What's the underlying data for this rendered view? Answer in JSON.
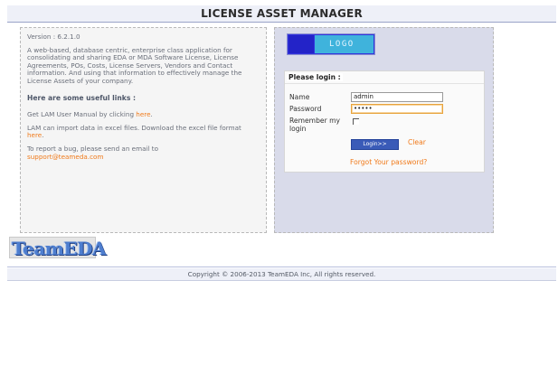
{
  "header": {
    "title": "LICENSE ASSET MANAGER"
  },
  "info": {
    "version": "Version : 6.2.1.0",
    "description": "A web-based, database centric, enterprise class application for consolidating and sharing EDA or MDA Software License, License Agreements, POs, Costs, License Servers, Vendors and Contact information. And using that information to effectively manage the License Assets of your company.",
    "links_heading": "Here are some useful links :",
    "manual_text": "Get LAM User Manual by clicking ",
    "manual_link": "here",
    "manual_suffix": ".",
    "import_text": "LAM can import data in excel files. Download the excel file format ",
    "import_link": "here",
    "import_suffix": ".",
    "bug_text": "To report a bug, please send an email to",
    "bug_email": "support@teameda.com"
  },
  "logo": {
    "text": "LOGO"
  },
  "login": {
    "title": "Please login :",
    "name_label": "Name",
    "name_value": "admin",
    "password_label": "Password",
    "password_value": "•••••",
    "remember_label_1": "Remember my",
    "remember_label_2": "login",
    "login_button": "Login>>",
    "clear_link": "Clear",
    "forgot_link": "Forgot Your password?"
  },
  "brand": {
    "logo_text": "TeamEDA"
  },
  "footer": {
    "copyright": "Copyright © 2006-2013 TeamEDA Inc, All rights reserved."
  },
  "colors": {
    "accent": "#f07a1a",
    "primary_button": "#3a5bb8",
    "panel_bg": "#d9dbea"
  }
}
